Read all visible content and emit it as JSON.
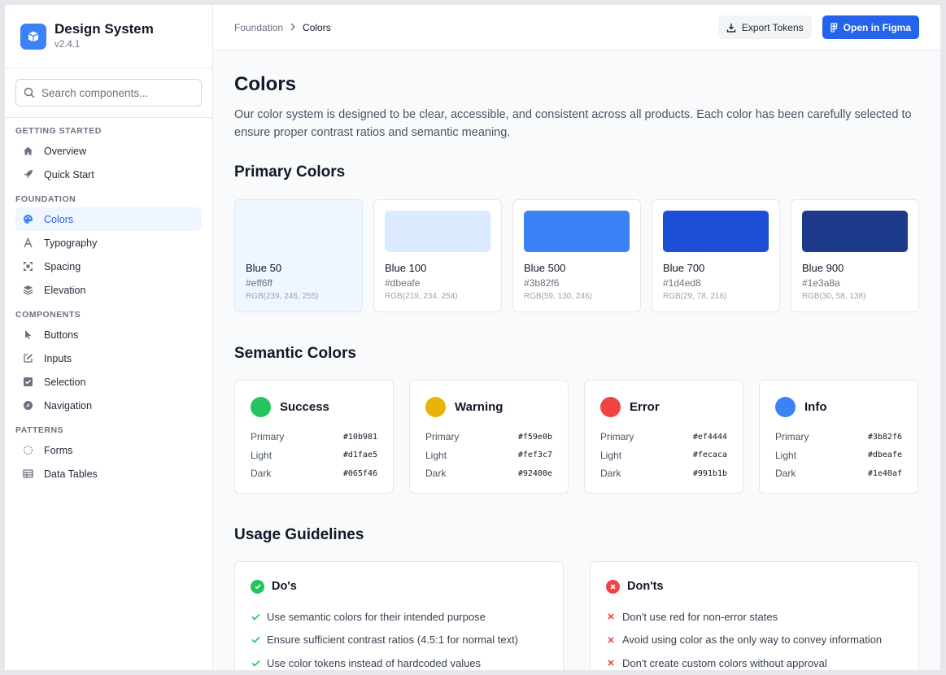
{
  "brand": {
    "title": "Design System",
    "version": "v2.4.1"
  },
  "search": {
    "placeholder": "Search components..."
  },
  "nav": {
    "getting_started": {
      "title": "Getting Started",
      "items": [
        "Overview",
        "Quick Start"
      ]
    },
    "foundation": {
      "title": "Foundation",
      "items": [
        "Colors",
        "Typography",
        "Spacing",
        "Elevation"
      ]
    },
    "components": {
      "title": "Components",
      "items": [
        "Buttons",
        "Inputs",
        "Selection",
        "Navigation"
      ]
    },
    "patterns": {
      "title": "Patterns",
      "items": [
        "Forms",
        "Data Tables"
      ]
    }
  },
  "breadcrumb": {
    "parent": "Foundation",
    "current": "Colors"
  },
  "actions": {
    "export": "Export Tokens",
    "figma": "Open in Figma"
  },
  "page": {
    "title": "Colors",
    "description": "Our color system is designed to be clear, accessible, and consistent across all products. Each color has been carefully selected to ensure proper contrast ratios and semantic meaning."
  },
  "primary": {
    "title": "Primary Colors",
    "swatches": [
      {
        "name": "Blue 50",
        "hex": "#eff6ff",
        "rgb": "RGB(239, 246, 255)"
      },
      {
        "name": "Blue 100",
        "hex": "#dbeafe",
        "rgb": "RGB(219, 234, 254)"
      },
      {
        "name": "Blue 500",
        "hex": "#3b82f6",
        "rgb": "RGB(59, 130, 246)"
      },
      {
        "name": "Blue 700",
        "hex": "#1d4ed8",
        "rgb": "RGB(29, 78, 216)"
      },
      {
        "name": "Blue 900",
        "hex": "#1e3a8a",
        "rgb": "RGB(30, 58, 138)"
      }
    ]
  },
  "semantic": {
    "title": "Semantic Colors",
    "labels": {
      "primary": "Primary",
      "light": "Light",
      "dark": "Dark"
    },
    "cards": [
      {
        "name": "Success",
        "primary": "#10b981",
        "light": "#d1fae5",
        "dark": "#065f46",
        "dot": "#22c55e"
      },
      {
        "name": "Warning",
        "primary": "#f59e0b",
        "light": "#fef3c7",
        "dark": "#92400e",
        "dot": "#eab308"
      },
      {
        "name": "Error",
        "primary": "#ef4444",
        "light": "#fecaca",
        "dark": "#991b1b",
        "dot": "#ef4444"
      },
      {
        "name": "Info",
        "primary": "#3b82f6",
        "light": "#dbeafe",
        "dark": "#1e40af",
        "dot": "#3b82f6"
      }
    ]
  },
  "guidelines": {
    "title": "Usage Guidelines",
    "dos": {
      "title": "Do's",
      "items": [
        "Use semantic colors for their intended purpose",
        "Ensure sufficient contrast ratios (4.5:1 for normal text)",
        "Use color tokens instead of hardcoded values"
      ]
    },
    "donts": {
      "title": "Don'ts",
      "items": [
        "Don't use red for non-error states",
        "Avoid using color as the only way to convey information",
        "Don't create custom colors without approval"
      ]
    }
  },
  "colors": {
    "accent": "#2563eb",
    "success": "#22c55e",
    "error": "#ef4444"
  }
}
